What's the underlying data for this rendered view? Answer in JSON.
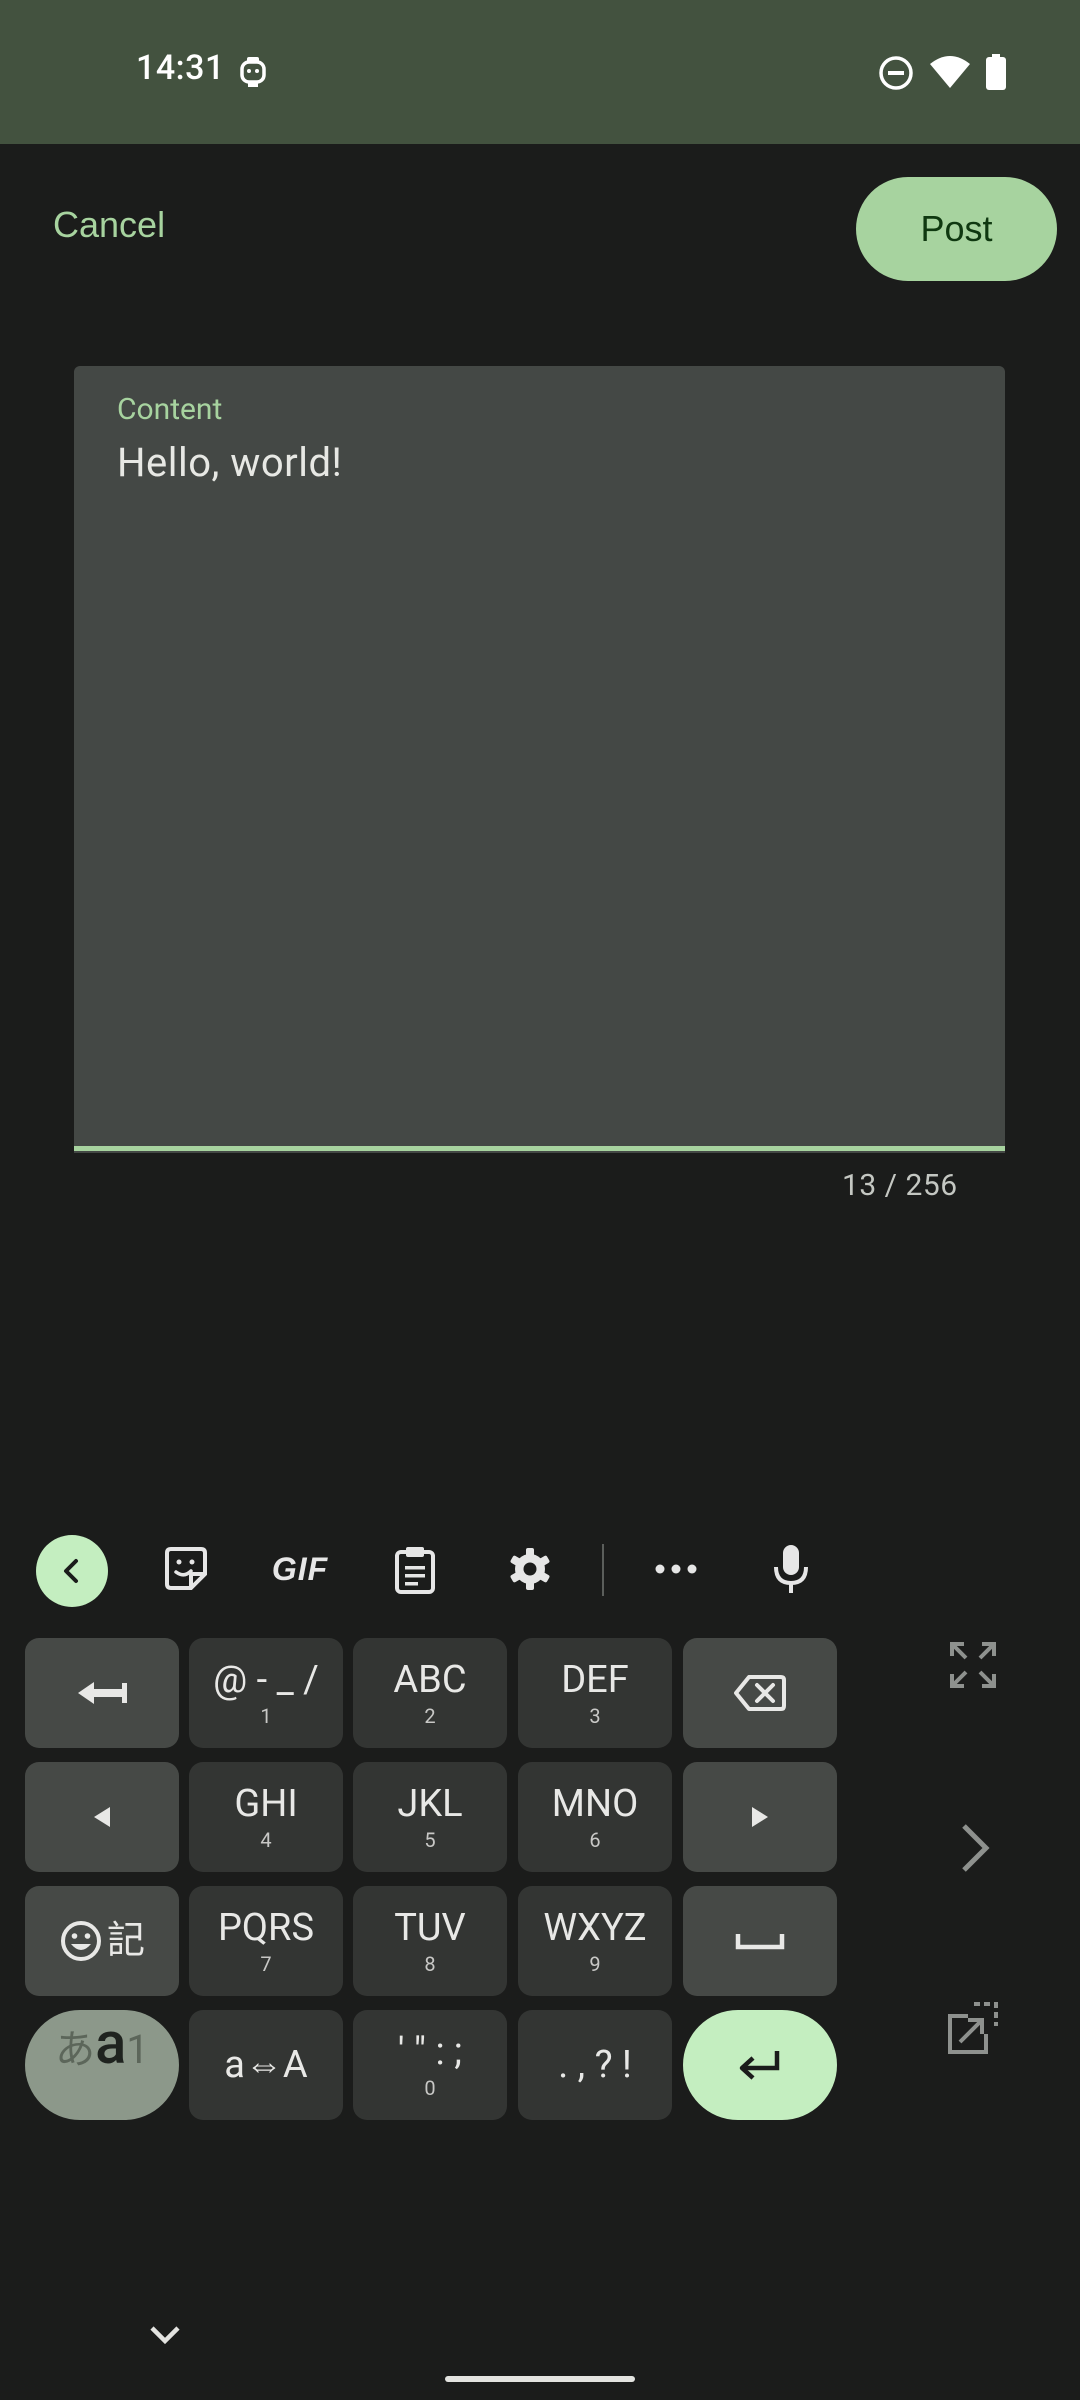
{
  "status_bar": {
    "time": "14:31",
    "icons": [
      "app-notification-icon",
      "do-not-disturb-icon",
      "wifi-icon",
      "battery-icon"
    ]
  },
  "app_bar": {
    "cancel_label": "Cancel",
    "post_label": "Post"
  },
  "editor": {
    "label": "Content",
    "value": "Hello, world!",
    "counter": "13 / 256"
  },
  "keyboard": {
    "toolbar": [
      "collapse-icon",
      "sticker-icon",
      "gif",
      "clipboard-icon",
      "settings-icon",
      "more-icon",
      "mic-icon"
    ],
    "gif_label": "GIF",
    "keys": {
      "k1": {
        "main": "@ - _ /",
        "sub": "1"
      },
      "k2": {
        "main": "ABC",
        "sub": "2"
      },
      "k3": {
        "main": "DEF",
        "sub": "3"
      },
      "k4": {
        "main": "GHI",
        "sub": "4"
      },
      "k5": {
        "main": "JKL",
        "sub": "5"
      },
      "k6": {
        "main": "MNO",
        "sub": "6"
      },
      "k7": {
        "main": "PQRS",
        "sub": "7"
      },
      "k8": {
        "main": "TUV",
        "sub": "8"
      },
      "k9": {
        "main": "WXYZ",
        "sub": "9"
      },
      "k0": {
        "main": "' \" : ;",
        "sub": "0"
      },
      "case": {
        "main": "a⇔A"
      },
      "punct": {
        "main": ". , ? !"
      },
      "emoji_kanji": {
        "main": "記"
      },
      "mode": {
        "hira": "あ",
        "a": "a",
        "one": "1"
      }
    },
    "colors": {
      "accent": "#a7d39f",
      "enter": "#c4eec0",
      "key": "#333533",
      "func_key": "#464946"
    }
  }
}
